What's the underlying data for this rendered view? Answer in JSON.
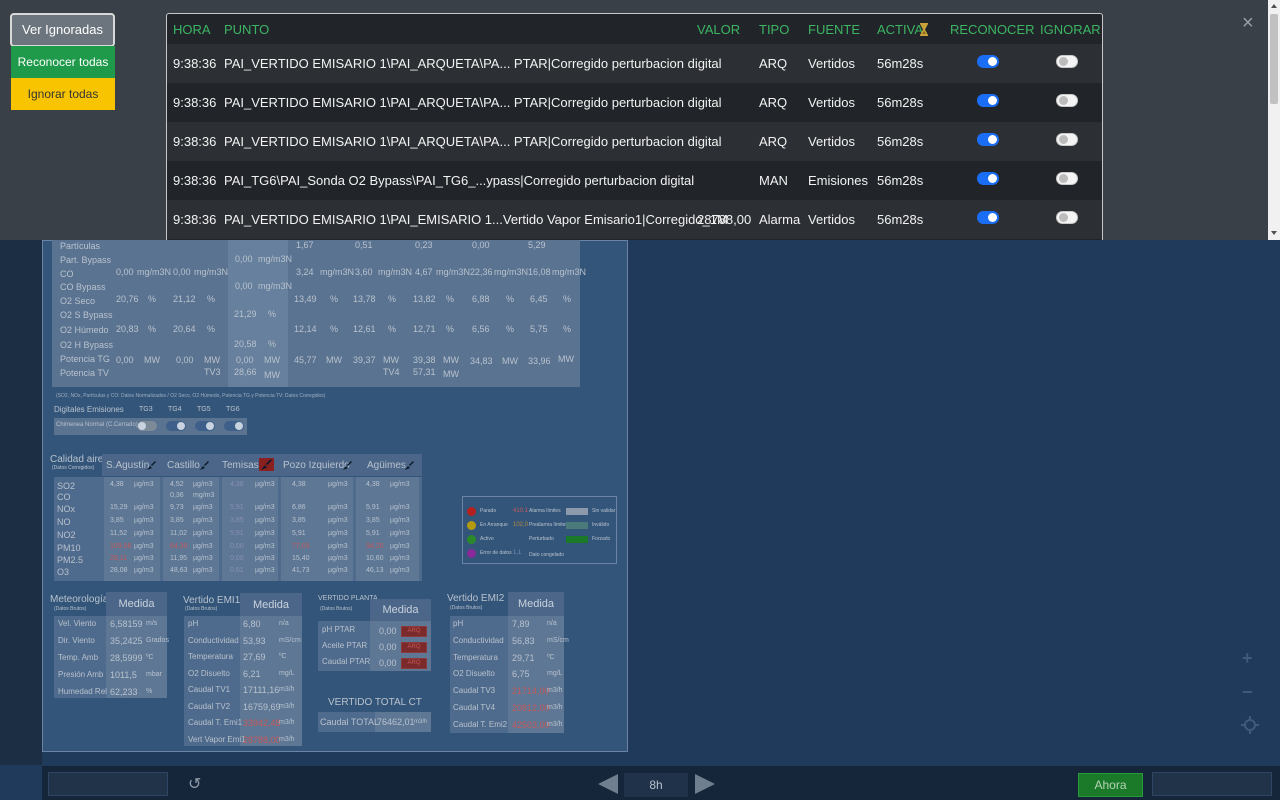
{
  "overlay": {
    "buttons": {
      "ver_ignoradas": "Ver Ignoradas",
      "reconocer_todas": "Reconocer todas",
      "ignorar_todas": "Ignorar todas"
    },
    "close_label": "×",
    "columns": [
      "HORA",
      "PUNTO",
      "VALOR",
      "TIPO",
      "FUENTE",
      "ACTIVA",
      "RECONOCER",
      "IGNORAR"
    ],
    "rows": [
      {
        "hora": "9:38:36",
        "punto": "PAI_VERTIDO EMISARIO 1\\PAI_ARQUETA\\PA... PTAR|Corregido perturbacion digital",
        "valor": "",
        "tipo": "ARQ",
        "fuente": "Vertidos",
        "activa": "56m28s",
        "reconocer": true,
        "ignorar": false
      },
      {
        "hora": "9:38:36",
        "punto": "PAI_VERTIDO EMISARIO 1\\PAI_ARQUETA\\PA... PTAR|Corregido perturbacion digital",
        "valor": "",
        "tipo": "ARQ",
        "fuente": "Vertidos",
        "activa": "56m28s",
        "reconocer": true,
        "ignorar": false
      },
      {
        "hora": "9:38:36",
        "punto": "PAI_VERTIDO EMISARIO 1\\PAI_ARQUETA\\PA... PTAR|Corregido perturbacion digital",
        "valor": "",
        "tipo": "ARQ",
        "fuente": "Vertidos",
        "activa": "56m28s",
        "reconocer": true,
        "ignorar": false
      },
      {
        "hora": "9:38:36",
        "punto": "PAI_TG6\\PAI_Sonda O2 Bypass\\PAI_TG6_...ypass|Corregido perturbacion digital",
        "valor": "",
        "tipo": "MAN",
        "fuente": "Emisiones",
        "activa": "56m28s",
        "reconocer": true,
        "ignorar": false
      },
      {
        "hora": "9:38:36",
        "punto": "PAI_VERTIDO EMISARIO 1\\PAI_EMISARIO 1...Vertido Vapor Emisario1|Corregido_1M",
        "valor": "28788,00",
        "tipo": "Alarma",
        "fuente": "Vertidos",
        "activa": "56m28s",
        "reconocer": true,
        "ignorar": false
      }
    ]
  },
  "emisiones": {
    "rows": [
      "Partículas",
      "Part. Bypass",
      "CO",
      "CO Bypass",
      "O2 Seco",
      "O2 S Bypass",
      "O2 Húmedo",
      "O2 H Bypass",
      "Potencia TG",
      "Potencia TV"
    ],
    "units": {
      "mg": "mg/m3N",
      "pct": "%",
      "mw": "MW"
    },
    "values": {
      "c1": {
        "co": "0,00",
        "o2s": "20,76",
        "o2h": "20,83",
        "pot": "0,00"
      },
      "c2": {
        "co": "0,00",
        "o2s": "21,12",
        "o2h": "20,64",
        "pot": "0,00",
        "tv": "TV3"
      },
      "c3": {
        "pb": "0,00",
        "cob": "0,00",
        "o2sb": "21,29",
        "o2hb": "20,58",
        "pot": "0,00",
        "tv": "28,66"
      },
      "c4": {
        "part": "1,67",
        "co": "3,24",
        "o2s": "13,49",
        "o2h": "12,14",
        "pot": "45,77"
      },
      "c5": {
        "part": "0,51",
        "co": "3,60",
        "o2s": "13,78",
        "o2h": "12,61",
        "pot": "39,37",
        "tv": "TV4"
      },
      "c6": {
        "part": "0,23",
        "co": "4,67",
        "o2s": "13,82",
        "o2h": "12,71",
        "pot": "39,38",
        "tv": "57,31"
      },
      "c7": {
        "part": "0,00",
        "co": "22,36",
        "o2s": "6,88",
        "o2h": "6,56",
        "pot": "34,83"
      },
      "c8": {
        "part": "5,29",
        "co": "16,08",
        "o2s": "6,45",
        "o2h": "5,75",
        "pot": "33,96"
      }
    },
    "footnote": "(SO2, NOx, Partículas y CO: Datos Normalizados / O2 Seco, O2 Húmedo, Potencia TG y Potencia TV: Datos Corregidos)"
  },
  "digitales": {
    "title": "Digitales Emisiones",
    "cols": [
      "TG3",
      "TG4",
      "TG5",
      "TG6"
    ],
    "row_label": "Chimenea Normal (C.Cerrado)",
    "states": [
      false,
      true,
      true,
      true
    ]
  },
  "calidad": {
    "title": "Calidad aire",
    "subtitle": "(Datos Corregidos)",
    "stations": [
      "S.Agustín",
      "Castillo",
      "Temisas",
      "Pozo Izquierdo",
      "Agüimes"
    ],
    "params": [
      "SO2",
      "CO",
      "NOx",
      "NO",
      "NO2",
      "PM10",
      "PM2.5",
      "O3"
    ],
    "unit": "µg/m3",
    "unit_co": "mg/m3",
    "values": [
      [
        "4,38",
        "",
        "15,29",
        "3,85",
        "11,52",
        "109,56",
        "29,11",
        "28,08"
      ],
      [
        "4,52",
        "0,36",
        "9,73",
        "3,85",
        "11,02",
        "64,30",
        "11,95",
        "48,63"
      ],
      [
        "4,38",
        "",
        "5,91",
        "3,85",
        "5,91",
        "0,00",
        "0,00",
        "0,61"
      ],
      [
        "4,38",
        "",
        "6,86",
        "3,85",
        "5,91",
        "77,03",
        "15,40",
        "41,73"
      ],
      [
        "4,38",
        "",
        "5,91",
        "3,85",
        "5,91",
        "94,25",
        "10,60",
        "46,13"
      ]
    ]
  },
  "leyenda": {
    "items": [
      "Parado",
      "En Arranque",
      "Activo",
      "Error de datos"
    ],
    "samples": [
      "410,1",
      "102,0",
      "",
      "1,1"
    ],
    "labels": [
      "Alarma límites",
      "Preálarma límites",
      "Perturbado",
      "Dato congelado"
    ],
    "swatches": [
      "Sin validar",
      "Inválido",
      "Forzado"
    ]
  },
  "meteo": {
    "title": "Meteorología",
    "subtitle": "(Datos Brutos)",
    "header": "Medida",
    "rows": [
      {
        "label": "Vel. Viento",
        "value": "6,58159",
        "unit": "m/s"
      },
      {
        "label": "Dir. Viento",
        "value": "35,2425",
        "unit": "Grados"
      },
      {
        "label": "Temp. Amb",
        "value": "28,5999",
        "unit": "ºC"
      },
      {
        "label": "Presión Amb",
        "value": "1011,5",
        "unit": "mbar"
      },
      {
        "label": "Humedad Rel",
        "value": "62,233",
        "unit": "%"
      }
    ]
  },
  "emi1": {
    "title": "Vertido EMI1",
    "subtitle": "(Datos Brutos)",
    "header": "Medida",
    "rows": [
      {
        "label": "pH",
        "value": "6,80",
        "unit": "n/a"
      },
      {
        "label": "Conductividad",
        "value": "53,93",
        "unit": "mS/cm"
      },
      {
        "label": "Temperatura",
        "value": "27,69",
        "unit": "ºC"
      },
      {
        "label": "O2 Disuelto",
        "value": "6,21",
        "unit": "mg/L"
      },
      {
        "label": "Caudal TV1",
        "value": "17111,16",
        "unit": "m3/h"
      },
      {
        "label": "Caudal TV2",
        "value": "16759,69",
        "unit": "m3/h"
      },
      {
        "label": "Caudal T. Emi1",
        "value": "33942,48",
        "unit": "m3/h"
      },
      {
        "label": "Vert Vapor Emi1",
        "value": "28788,00",
        "unit": "m3/h"
      }
    ]
  },
  "planta": {
    "title": "VERTIDO PLANTA",
    "subtitle": "(Datos Brutos)",
    "header": "Medida",
    "rows": [
      {
        "label": "pH PTAR",
        "value": "0,00",
        "flag": "ARQ"
      },
      {
        "label": "Aceite PTAR",
        "value": "0,00",
        "flag": "ARQ"
      },
      {
        "label": "Caudal PTAR",
        "value": "0,00",
        "flag": "ARQ"
      }
    ]
  },
  "total": {
    "title": "VERTIDO TOTAL CT",
    "label": "Caudal TOTAL",
    "value": "76462,01",
    "unit": "m3/h"
  },
  "emi2": {
    "title": "Vertido EMI2",
    "subtitle": "(Datos Brutos)",
    "header": "Medida",
    "rows": [
      {
        "label": "pH",
        "value": "7,89",
        "unit": "n/a"
      },
      {
        "label": "Conductividad",
        "value": "56,83",
        "unit": "mS/cm"
      },
      {
        "label": "Temperatura",
        "value": "29,71",
        "unit": "ºC"
      },
      {
        "label": "O2 Disuelto",
        "value": "6,75",
        "unit": "mg/L"
      },
      {
        "label": "Caudal TV3",
        "value": "21714,00",
        "unit": "m3/h"
      },
      {
        "label": "Caudal TV4",
        "value": "20812,00",
        "unit": "m3/h"
      },
      {
        "label": "Caudal T. Emi2",
        "value": "42503,00",
        "unit": "m3/h"
      }
    ]
  },
  "bottom": {
    "range": "8h",
    "ahora": "Ahora",
    "refresh": "↺",
    "zoom_in": "+",
    "zoom_out": "−"
  },
  "colors": {
    "green_header": "#3cb563",
    "switch_on": "#1a6ef5",
    "reconocer_btn": "#1e9a4a",
    "ignorar_btn": "#f8c400"
  }
}
